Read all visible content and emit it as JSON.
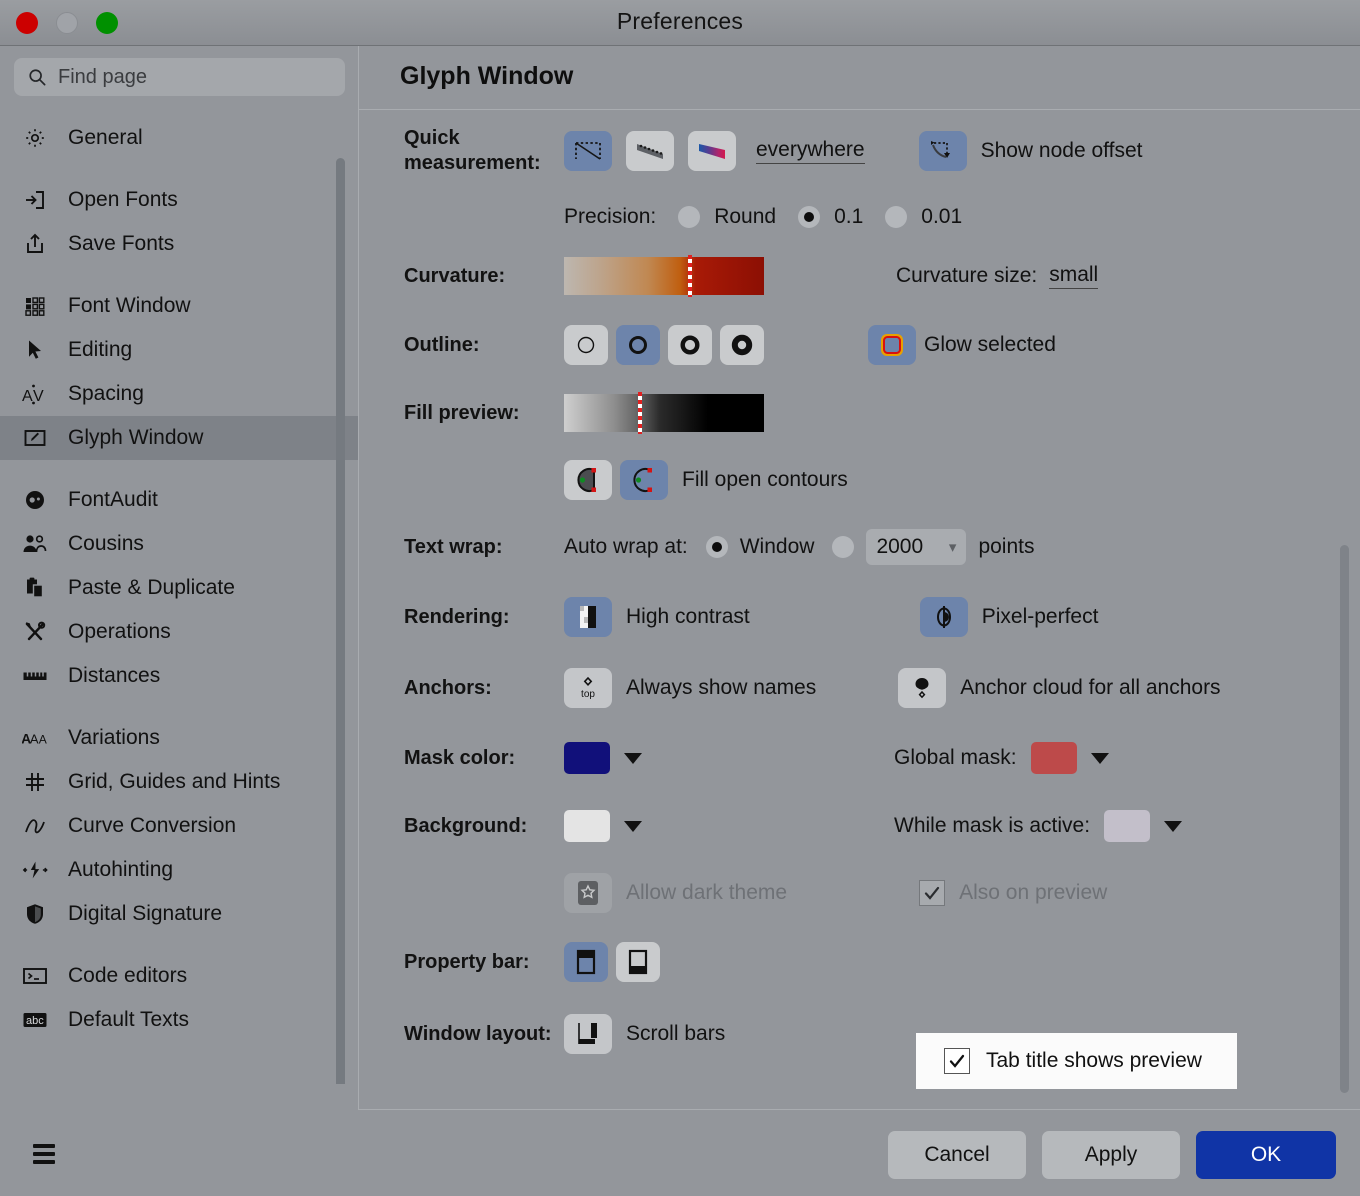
{
  "window": {
    "title": "Preferences",
    "traffic_lights": [
      "close",
      "minimize",
      "zoom"
    ]
  },
  "sidebar": {
    "search": {
      "placeholder": "Find page",
      "value": "",
      "icon": "search-icon"
    },
    "items": [
      {
        "label": "General",
        "icon": "gear-icon",
        "selected": false
      },
      {
        "label": "Open Fonts",
        "icon": "open-fonts-icon",
        "selected": false
      },
      {
        "label": "Save Fonts",
        "icon": "save-fonts-icon",
        "selected": false
      },
      {
        "label": "Font Window",
        "icon": "font-window-icon",
        "selected": false
      },
      {
        "label": "Editing",
        "icon": "cursor-arrow-icon",
        "selected": false
      },
      {
        "label": "Spacing",
        "icon": "spacing-av-icon",
        "selected": false
      },
      {
        "label": "Glyph Window",
        "icon": "glyph-window-icon",
        "selected": true
      },
      {
        "label": "FontAudit",
        "icon": "fontaudit-icon",
        "selected": false
      },
      {
        "label": "Cousins",
        "icon": "cousins-people-icon",
        "selected": false
      },
      {
        "label": "Paste & Duplicate",
        "icon": "clipboard-icon",
        "selected": false
      },
      {
        "label": "Operations",
        "icon": "tools-icon",
        "selected": false
      },
      {
        "label": "Distances",
        "icon": "ruler-icon",
        "selected": false
      },
      {
        "label": "Variations",
        "icon": "variations-aaa-icon",
        "selected": false
      },
      {
        "label": "Grid, Guides and Hints",
        "icon": "grid-hash-icon",
        "selected": false
      },
      {
        "label": "Curve Conversion",
        "icon": "curve-icon",
        "selected": false
      },
      {
        "label": "Autohinting",
        "icon": "autohinting-bolt-icon",
        "selected": false
      },
      {
        "label": "Digital Signature",
        "icon": "shield-icon",
        "selected": false
      },
      {
        "label": "Code editors",
        "icon": "terminal-icon",
        "selected": false
      },
      {
        "label": "Default Texts",
        "icon": "abc-icon",
        "selected": false
      }
    ]
  },
  "main": {
    "page_title": "Glyph Window",
    "quick_measurement": {
      "label": "Quick measurement:",
      "options": [
        {
          "name": "measure-box-icon",
          "selected": true
        },
        {
          "name": "measure-dotted-bar-icon",
          "selected": false
        },
        {
          "name": "measure-color-bar-icon",
          "selected": false
        }
      ],
      "scope_link": "everywhere",
      "show_node_offset": {
        "label": "Show node offset",
        "enabled": true
      },
      "precision": {
        "label": "Precision:",
        "options": [
          "Round",
          "0.1",
          "0.01"
        ],
        "selected": "0.1"
      }
    },
    "curvature": {
      "label": "Curvature:",
      "gradient": {
        "from": "#bdb7b0",
        "mid": "#c05f10",
        "to": "#8c0f04",
        "marker_pct": 62
      },
      "size_label": "Curvature size:",
      "size_value": "small"
    },
    "outline": {
      "label": "Outline:",
      "weights": [
        1,
        2,
        3,
        4
      ],
      "selected_index": 1,
      "glow_selected": {
        "label": "Glow selected",
        "enabled": true
      }
    },
    "fill_preview": {
      "label": "Fill preview:",
      "gradient": {
        "from": "#cfcfcf",
        "to": "#000000",
        "marker_pct": 37
      },
      "open_contours": [
        {
          "name": "fill-open-contour-filled-icon",
          "selected": false
        },
        {
          "name": "fill-open-contour-outline-icon",
          "selected": true
        }
      ],
      "open_contours_label": "Fill open contours"
    },
    "text_wrap": {
      "label": "Text wrap:",
      "auto_wrap_label": "Auto wrap at:",
      "option_window": "Window",
      "option_points_value": "2000",
      "points_suffix": "points",
      "selected": "Window"
    },
    "rendering": {
      "label": "Rendering:",
      "high_contrast": {
        "label": "High contrast",
        "enabled": true
      },
      "pixel_perfect": {
        "label": "Pixel-perfect",
        "enabled": true
      }
    },
    "anchors": {
      "label": "Anchors:",
      "always_show_names": {
        "label": "Always show names",
        "enabled": false
      },
      "anchor_cloud": {
        "label": "Anchor cloud for all anchors",
        "enabled": false
      }
    },
    "mask_color": {
      "label": "Mask color:",
      "value": "#11107a",
      "global_label": "Global mask:",
      "global_value": "#bd4a4a"
    },
    "background": {
      "label": "Background:",
      "value": "#e4e4e4",
      "while_mask_label": "While mask is active:",
      "while_mask_value": "#c3bfca",
      "allow_dark_theme": {
        "label": "Allow dark theme",
        "enabled": false
      },
      "also_on_preview": {
        "label": "Also on preview",
        "enabled": true
      }
    },
    "property_bar": {
      "label": "Property bar:",
      "options": [
        {
          "name": "property-bar-top-icon",
          "selected": true
        },
        {
          "name": "property-bar-bottom-icon",
          "selected": false
        }
      ]
    },
    "window_layout": {
      "label": "Window layout:",
      "scroll_bars": {
        "label": "Scroll bars",
        "enabled": false
      },
      "tab_title_preview": {
        "label": "Tab title shows preview",
        "enabled": true
      }
    }
  },
  "footer": {
    "menu_icon": "hamburger-menu-icon",
    "cancel_label": "Cancel",
    "apply_label": "Apply",
    "ok_label": "OK",
    "accent": "#1034a6"
  }
}
